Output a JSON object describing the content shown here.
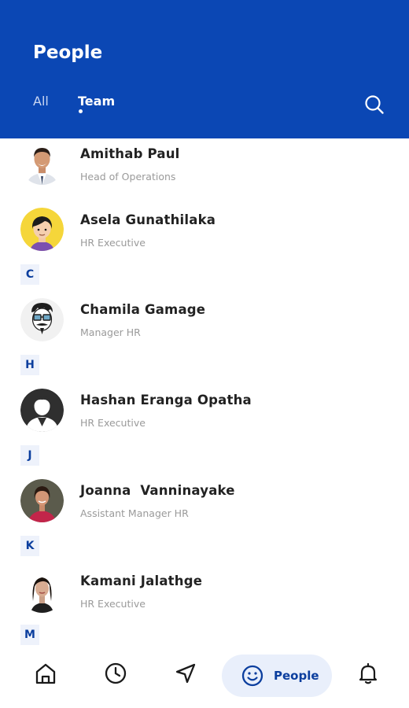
{
  "header": {
    "title": "People",
    "tabs": [
      {
        "label": "All",
        "active": false
      },
      {
        "label": "Team",
        "active": true
      }
    ],
    "search_icon": "search-icon",
    "background_color": "#0b47b4"
  },
  "list": {
    "people": [
      {
        "name": "Amithab Paul",
        "role": "Head of Operations",
        "avatar": "photo-man-suit"
      },
      {
        "name": "Asela Gunathilaka",
        "role": "HR Executive",
        "avatar": "cartoon-yellow"
      },
      {
        "name": "Chamila Gamage",
        "role": "Manager HR",
        "avatar": "illustration-glasses-beard"
      },
      {
        "name": "Hashan Eranga Opatha",
        "role": "HR Executive",
        "avatar": "default-silhouette"
      },
      {
        "name": "Joanna  Vanninayake",
        "role": "Assistant Manager HR",
        "avatar": "photo-woman-red"
      },
      {
        "name": "Kamani Jalathge",
        "role": "HR Executive",
        "avatar": "photo-woman-dark-hair"
      }
    ],
    "sections": [
      "C",
      "H",
      "J",
      "K",
      "M"
    ]
  },
  "bottom_nav": {
    "items": [
      {
        "icon": "home-icon"
      },
      {
        "icon": "clock-icon"
      },
      {
        "icon": "navigation-icon"
      },
      {
        "icon": "smiley-icon",
        "label": "People",
        "active": true
      },
      {
        "icon": "bell-icon"
      }
    ],
    "accent_color": "#0b3e9e"
  }
}
